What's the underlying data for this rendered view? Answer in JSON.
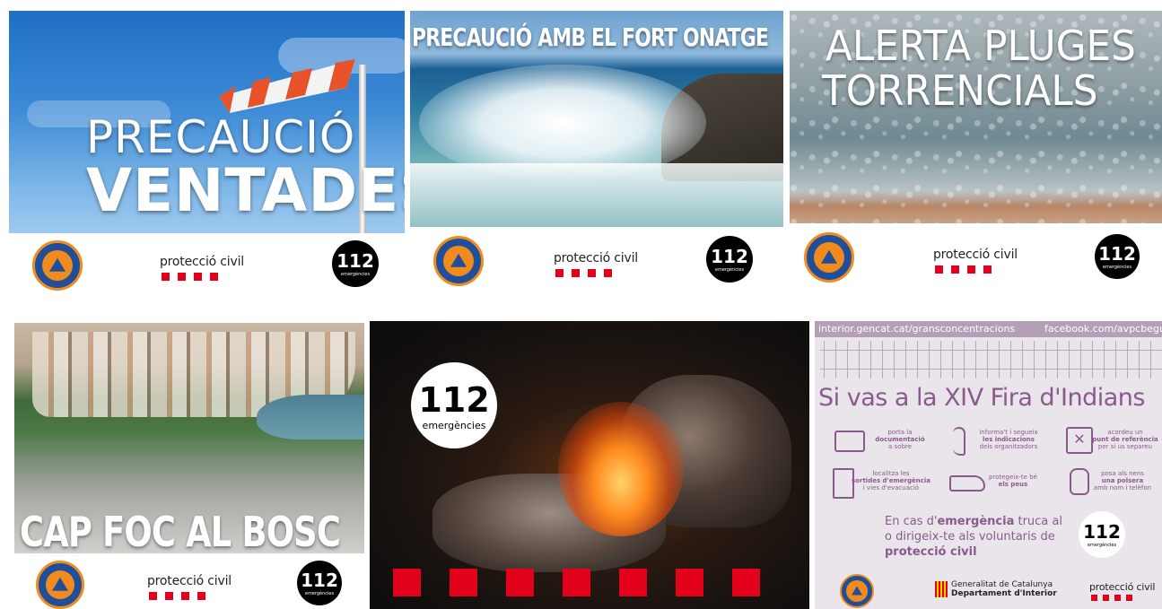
{
  "tiles": {
    "t1": {
      "line1": "PRECAUCIÓ",
      "line2": "VENTADES"
    },
    "t2": {
      "headline": "PRECAUCIÓ AMB EL FORT ONATGE"
    },
    "t3": {
      "line1": "ALERTA PLUGES",
      "line2": "TORRENCIALS"
    },
    "t4": {
      "headline": "CAP FOC AL BOSC"
    },
    "t6": {
      "url_left": "interior.gencat.cat/gransconcentracions",
      "url_right": "facebook.com/avpcbegur",
      "title": "Si vas a la XIV Fira d'Indians",
      "tips": [
        {
          "pre": "porta la",
          "bold": "documentació",
          "post": "a sobre"
        },
        {
          "pre": "informa't i segueix",
          "bold": "les indicacions",
          "post": "dels organitzadors"
        },
        {
          "pre": "acordeu un",
          "bold": "punt de referència",
          "post": "per si us separeu"
        },
        {
          "pre": "localitza les",
          "bold": "sortides d'emergència",
          "post": "i vies d'evacuació"
        },
        {
          "pre": "protegeix-te bé",
          "bold": "els peus",
          "post": ""
        },
        {
          "pre": "posa als nens",
          "bold": "una polsera",
          "post": "amb nom i telèfon"
        }
      ],
      "emergency_l1_pre": "En cas d'",
      "emergency_l1_bold": "emergència",
      "emergency_l1_post": " truca al",
      "emergency_l2": "o dirigeix-te als voluntaris de",
      "emergency_l3": "protecció civil",
      "gencat_l1": "Generalitat de Catalunya",
      "gencat_l2": "Departament d'Interior"
    }
  },
  "brand": {
    "protecciocivil": "protecció civil",
    "n112": "112",
    "emergencies": "emergències",
    "avpc_ring": "AV PROTECCIÓ CIVIL BEGUR"
  },
  "colors": {
    "pc_red": "#e3001b",
    "av_blue": "#1f4f9a",
    "av_orange": "#f28b1d",
    "info_purple": "#8a5a8e",
    "info_bg": "#e9e5ea"
  }
}
